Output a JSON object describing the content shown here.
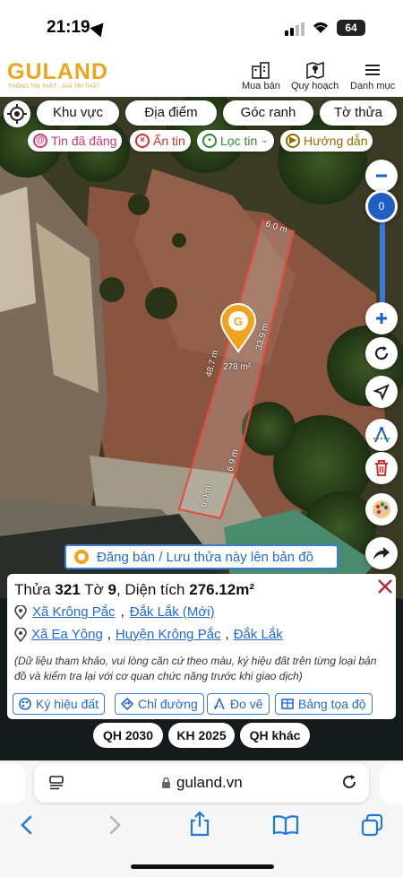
{
  "status": {
    "time": "21:19",
    "battery": "64"
  },
  "header": {
    "logo": "GULAND",
    "slogan": "THÔNG TIN THẬT - GIÁ TRỊ THẬT",
    "nav": [
      {
        "label": "Mua bán",
        "icon": "building-icon"
      },
      {
        "label": "Quy hoạch",
        "icon": "map-pin-icon"
      },
      {
        "label": "Danh mục",
        "icon": "menu-icon"
      }
    ]
  },
  "search_tabs": [
    "Khu vực",
    "Địa điểm",
    "Góc ranh",
    "Tờ thửa"
  ],
  "filters": [
    {
      "label": "Tin đã đăng",
      "icon": "posted-icon",
      "color": "#d03a6a"
    },
    {
      "label": "Ẩn tin",
      "icon": "hide-icon",
      "color": "#d03030"
    },
    {
      "label": "Lọc tin",
      "icon": "filter-pin-icon",
      "color": "#2e8b3a"
    },
    {
      "label": "Hướng dẫn",
      "icon": "play-icon",
      "color": "#9a6a00"
    }
  ],
  "map": {
    "zoom_level": "0",
    "parcel": {
      "edge_top": "6.0 m",
      "edge_right": "33.9 m",
      "edge_left": "48.7 m",
      "edge_lower_right": "6.9 m",
      "edge_bottom": "6.0 m",
      "area": "278 m²"
    },
    "post_banner": "Đăng bán / Lưu thửa này lên bản đồ"
  },
  "parcel_info": {
    "prefix": "Thửa",
    "plot_no": "321",
    "sheet_prefix": "Tờ",
    "sheet_no": "9",
    "area_label": ", Diện tích",
    "area": "276.12m²",
    "new_address": {
      "commune": "Xã Krông Pắc",
      "province": "Đắk Lắk (Mới)"
    },
    "old_address": {
      "commune": "Xã Ea Yông",
      "district": "Huyện Krông Pắc",
      "province": "Đắk Lắk"
    },
    "note": "(Dữ liệu tham khảo, vui lòng căn cứ theo màu, ký hiệu đất trên từng loại bản đồ và kiểm tra lại với cơ quan chức năng trước khi giao dịch)",
    "actions": [
      {
        "label": "Ký hiệu đất",
        "icon": "palette-icon"
      },
      {
        "label": "Chỉ đường",
        "icon": "directions-icon"
      },
      {
        "label": "Đo vẽ",
        "icon": "measure-icon"
      },
      {
        "label": "Bảng tọa độ",
        "icon": "table-icon"
      }
    ]
  },
  "planning_tabs": [
    "QH 2030",
    "KH 2025",
    "QH khác"
  ],
  "browser": {
    "url": "guland.vn"
  }
}
